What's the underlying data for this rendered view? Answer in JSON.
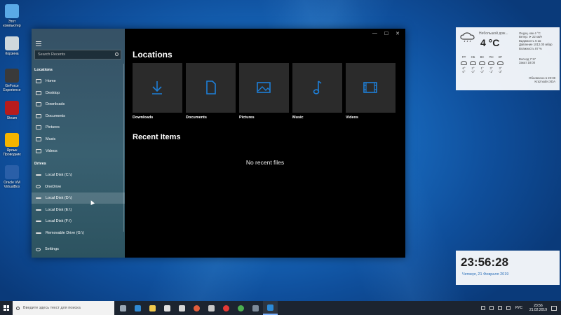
{
  "desktop": {
    "icons": [
      {
        "label": "Этот компьютер",
        "color": "#5aa9e6",
        "icon": "computer-icon"
      },
      {
        "label": "Корзина",
        "color": "#cfd8dc",
        "icon": "recycle-bin-icon"
      },
      {
        "label": "GeForce Experience",
        "color": "#3a3a3a",
        "icon": "geforce-icon"
      },
      {
        "label": "Steam",
        "color": "#b71c1c",
        "icon": "steam-icon"
      },
      {
        "label": "Ярлык Проводник",
        "color": "#f4b400",
        "icon": "folder-icon"
      },
      {
        "label": "Oracle VM VirtualBox",
        "color": "#2a5fa8",
        "icon": "virtualbox-icon"
      }
    ]
  },
  "explorer": {
    "search_placeholder": "Search Recents",
    "sections": {
      "locations": "Locations",
      "drives": "Drives"
    },
    "locations_nav": [
      {
        "label": "Home",
        "icon": "home-icon"
      },
      {
        "label": "Desktop",
        "icon": "desktop-icon"
      },
      {
        "label": "Downloads",
        "icon": "download-icon"
      },
      {
        "label": "Documents",
        "icon": "document-icon"
      },
      {
        "label": "Pictures",
        "icon": "picture-icon"
      },
      {
        "label": "Music",
        "icon": "music-icon"
      },
      {
        "label": "Videos",
        "icon": "video-icon"
      }
    ],
    "drives_nav": [
      {
        "label": "Local Disk (C:\\)",
        "icon": "disk-icon"
      },
      {
        "label": "OneDrive",
        "icon": "cloud-icon"
      },
      {
        "label": "Local Disk (D:\\)",
        "icon": "disk-icon"
      },
      {
        "label": "Local Disk (E:\\)",
        "icon": "disk-icon"
      },
      {
        "label": "Local Disk (F:\\)",
        "icon": "disk-icon"
      },
      {
        "label": "Removable Drive (G:\\)",
        "icon": "usb-drive-icon"
      }
    ],
    "settings_label": "Settings",
    "main": {
      "locations_heading": "Locations",
      "tiles": [
        {
          "label": "Downloads",
          "icon": "download-icon"
        },
        {
          "label": "Documents",
          "icon": "document-icon"
        },
        {
          "label": "Pictures",
          "icon": "picture-icon"
        },
        {
          "label": "Music",
          "icon": "music-icon"
        },
        {
          "label": "Videos",
          "icon": "video-icon"
        }
      ],
      "recent_heading": "Recent Items",
      "no_recent_text": "No recent files"
    },
    "window_controls": {
      "minimize": "—",
      "maximize": "☐",
      "close": "✕"
    },
    "accent_color": "#1e7fd8"
  },
  "weather": {
    "description": "Небольшой дож...",
    "temperature": "4 °C",
    "details": [
      "Ощущ. как 4 °C",
      "Ветер: ➤ 22 км/ч",
      "Видимость 5 км",
      "Давление 1012.00 мбар",
      "Влажность 87 %"
    ],
    "days": [
      {
        "name": "ПТ",
        "hi": "6°",
        "lo": "0°"
      },
      {
        "name": "СБ",
        "hi": "2°",
        "lo": "-2°"
      },
      {
        "name": "ВС",
        "hi": "1°",
        "lo": "-2°"
      },
      {
        "name": "ПН",
        "hi": "3°",
        "lo": "-1°"
      },
      {
        "name": "ВТ",
        "hi": "3°",
        "lo": "-2°"
      }
    ],
    "sunrise": "Восход 7:17",
    "sunset": "Закат 18:00",
    "updated": "Обновлено в 23:38",
    "source": "Kraznoder.XDA",
    "side_icons": [
      "•",
      "•",
      "•",
      "•",
      "•"
    ]
  },
  "clock_widget": {
    "time": "23:56:28",
    "date": "Четверг, 21 Февраля 2019"
  },
  "taskbar": {
    "search_placeholder": "Введите здесь текст для поиска",
    "apps": [
      {
        "name": "task-view",
        "color": "#9aa7b5"
      },
      {
        "name": "edge",
        "color": "#2f89d4"
      },
      {
        "name": "file-explorer",
        "color": "#f2c94c"
      },
      {
        "name": "store",
        "color": "#e0e0e0"
      },
      {
        "name": "mail",
        "color": "#d6d6d6"
      },
      {
        "name": "media-player",
        "color": "#e25d3c"
      },
      {
        "name": "people",
        "color": "#c9c9c9"
      },
      {
        "name": "opera",
        "color": "#e53935"
      },
      {
        "name": "chrome",
        "color": "#4caf50"
      },
      {
        "name": "explorer-app",
        "color": "#7c8a99"
      },
      {
        "name": "files-app",
        "color": "#2b8ad8"
      }
    ],
    "language": "РУС",
    "clock_time": "23:56",
    "clock_date": "21.02.2019"
  }
}
